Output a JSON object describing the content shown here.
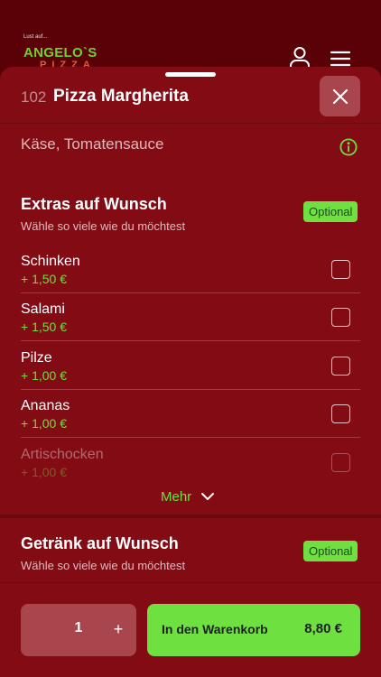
{
  "header": {
    "logo_tagline": "Lust auf...",
    "logo_name": "ANGELO`S",
    "logo_sub": "PIZZA",
    "user_icon": "user-icon",
    "menu_icon": "hamburger-menu-icon"
  },
  "item": {
    "number": "102",
    "title": "Pizza Margherita",
    "description": "Käse, Tomatensauce",
    "close_icon": "close-icon",
    "info_icon": "info-icon"
  },
  "extras": {
    "title": "Extras auf Wunsch",
    "subtitle": "Wähle so viele wie du möchtest",
    "badge": "Optional",
    "options": [
      {
        "name": "Schinken",
        "price": "+ 1,50 €",
        "checked": false
      },
      {
        "name": "Salami",
        "price": "+ 1,50 €",
        "checked": false
      },
      {
        "name": "Pilze",
        "price": "+ 1,00 €",
        "checked": false
      },
      {
        "name": "Ananas",
        "price": "+ 1,00 €",
        "checked": false
      },
      {
        "name": "Artischocken",
        "price": "+ 1,00 €",
        "checked": false
      }
    ],
    "more_label": "Mehr",
    "more_icon": "chevron-down-icon"
  },
  "drinks": {
    "title": "Getränk auf Wunsch",
    "subtitle": "Wähle so viele wie du möchtest",
    "badge": "Optional"
  },
  "footer": {
    "quantity": "1",
    "plus_label": "+",
    "cart_label": "In den Warenkorb",
    "cart_price": "8,80 €"
  },
  "colors": {
    "accent_green": "#6ee03f",
    "sheet_red": "#820b14",
    "header_dark_red": "#5a0007"
  }
}
